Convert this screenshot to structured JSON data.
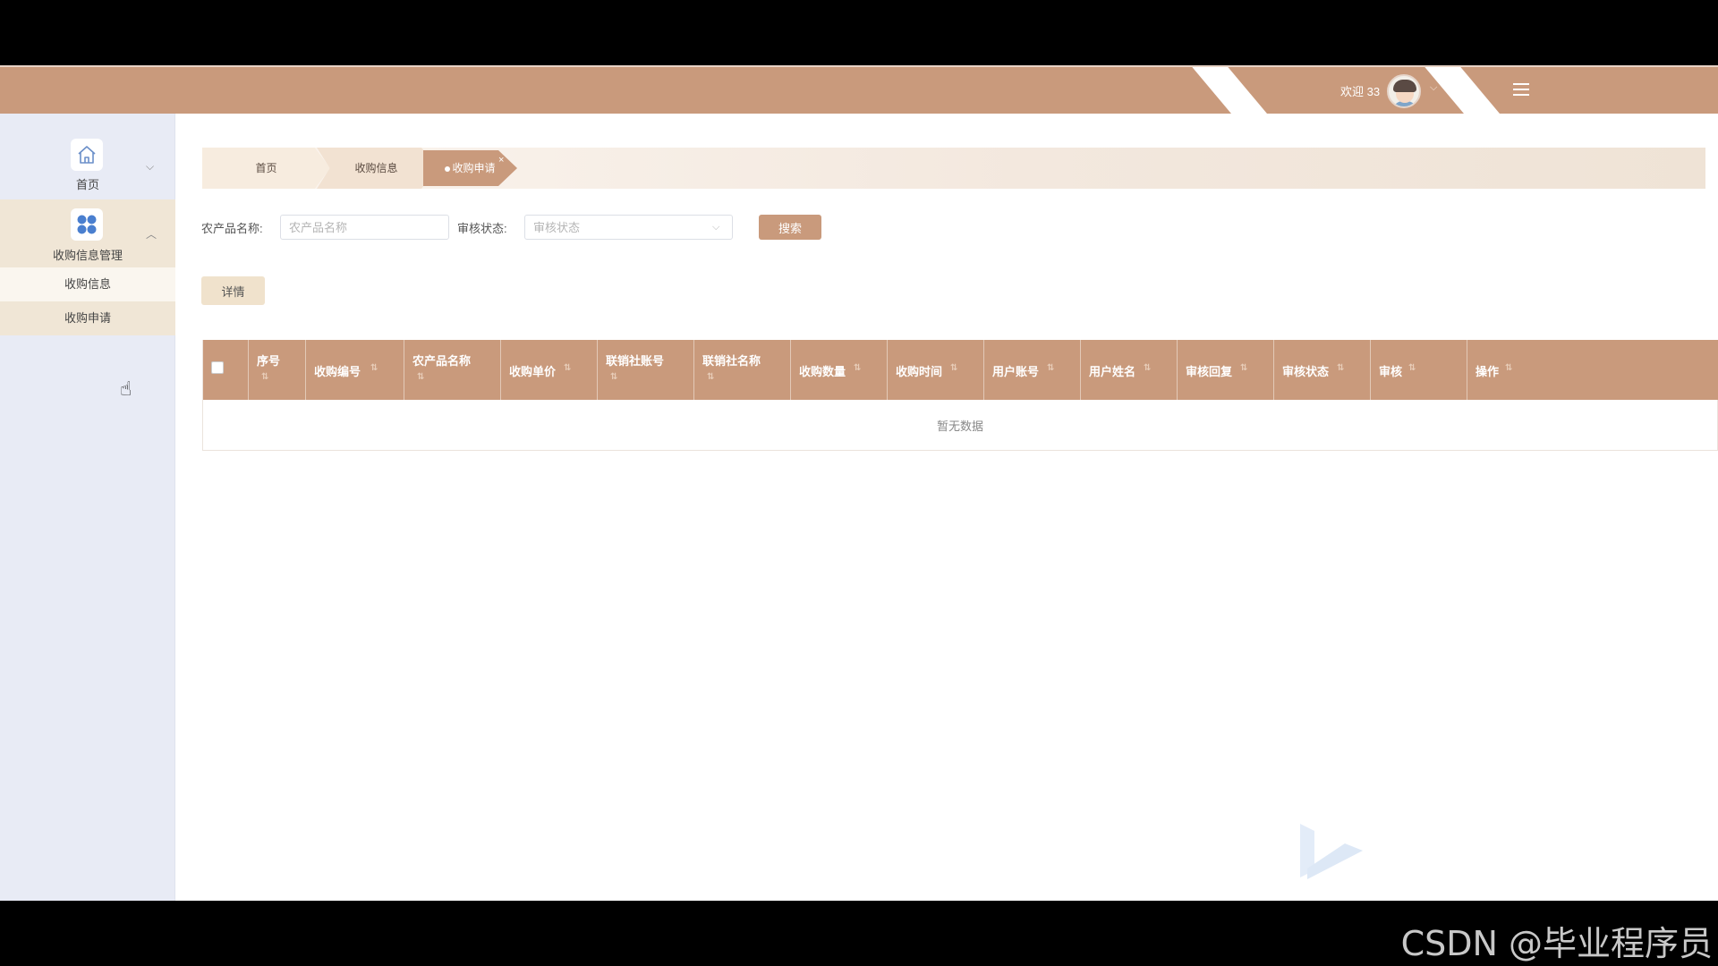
{
  "header": {
    "welcome": "欢迎 33",
    "colors": {
      "brand": "#c99a7c",
      "sidebar_bg": "#e8ebf5",
      "sub_active": "#f0e6d6"
    }
  },
  "sidebar": {
    "home_label": "首页",
    "group_label": "收购信息管理",
    "sub_items": [
      "收购信息",
      "收购申请"
    ]
  },
  "breadcrumb": {
    "items": [
      "首页",
      "收购信息",
      "收购申请"
    ],
    "close_icon": "×"
  },
  "search": {
    "product_label": "农产品名称:",
    "product_placeholder": "农产品名称",
    "status_label": "审核状态:",
    "status_placeholder": "审核状态",
    "button": "搜索"
  },
  "toolbar": {
    "detail": "详情"
  },
  "table": {
    "columns": [
      "序号",
      "收购编号",
      "农产品名称",
      "收购单价",
      "联销社账号",
      "联销社名称",
      "收购数量",
      "收购时间",
      "用户账号",
      "用户姓名",
      "审核回复",
      "审核状态",
      "审核",
      "操作"
    ],
    "empty_text": "暂无数据"
  },
  "watermark": "CSDN @毕业程序员"
}
